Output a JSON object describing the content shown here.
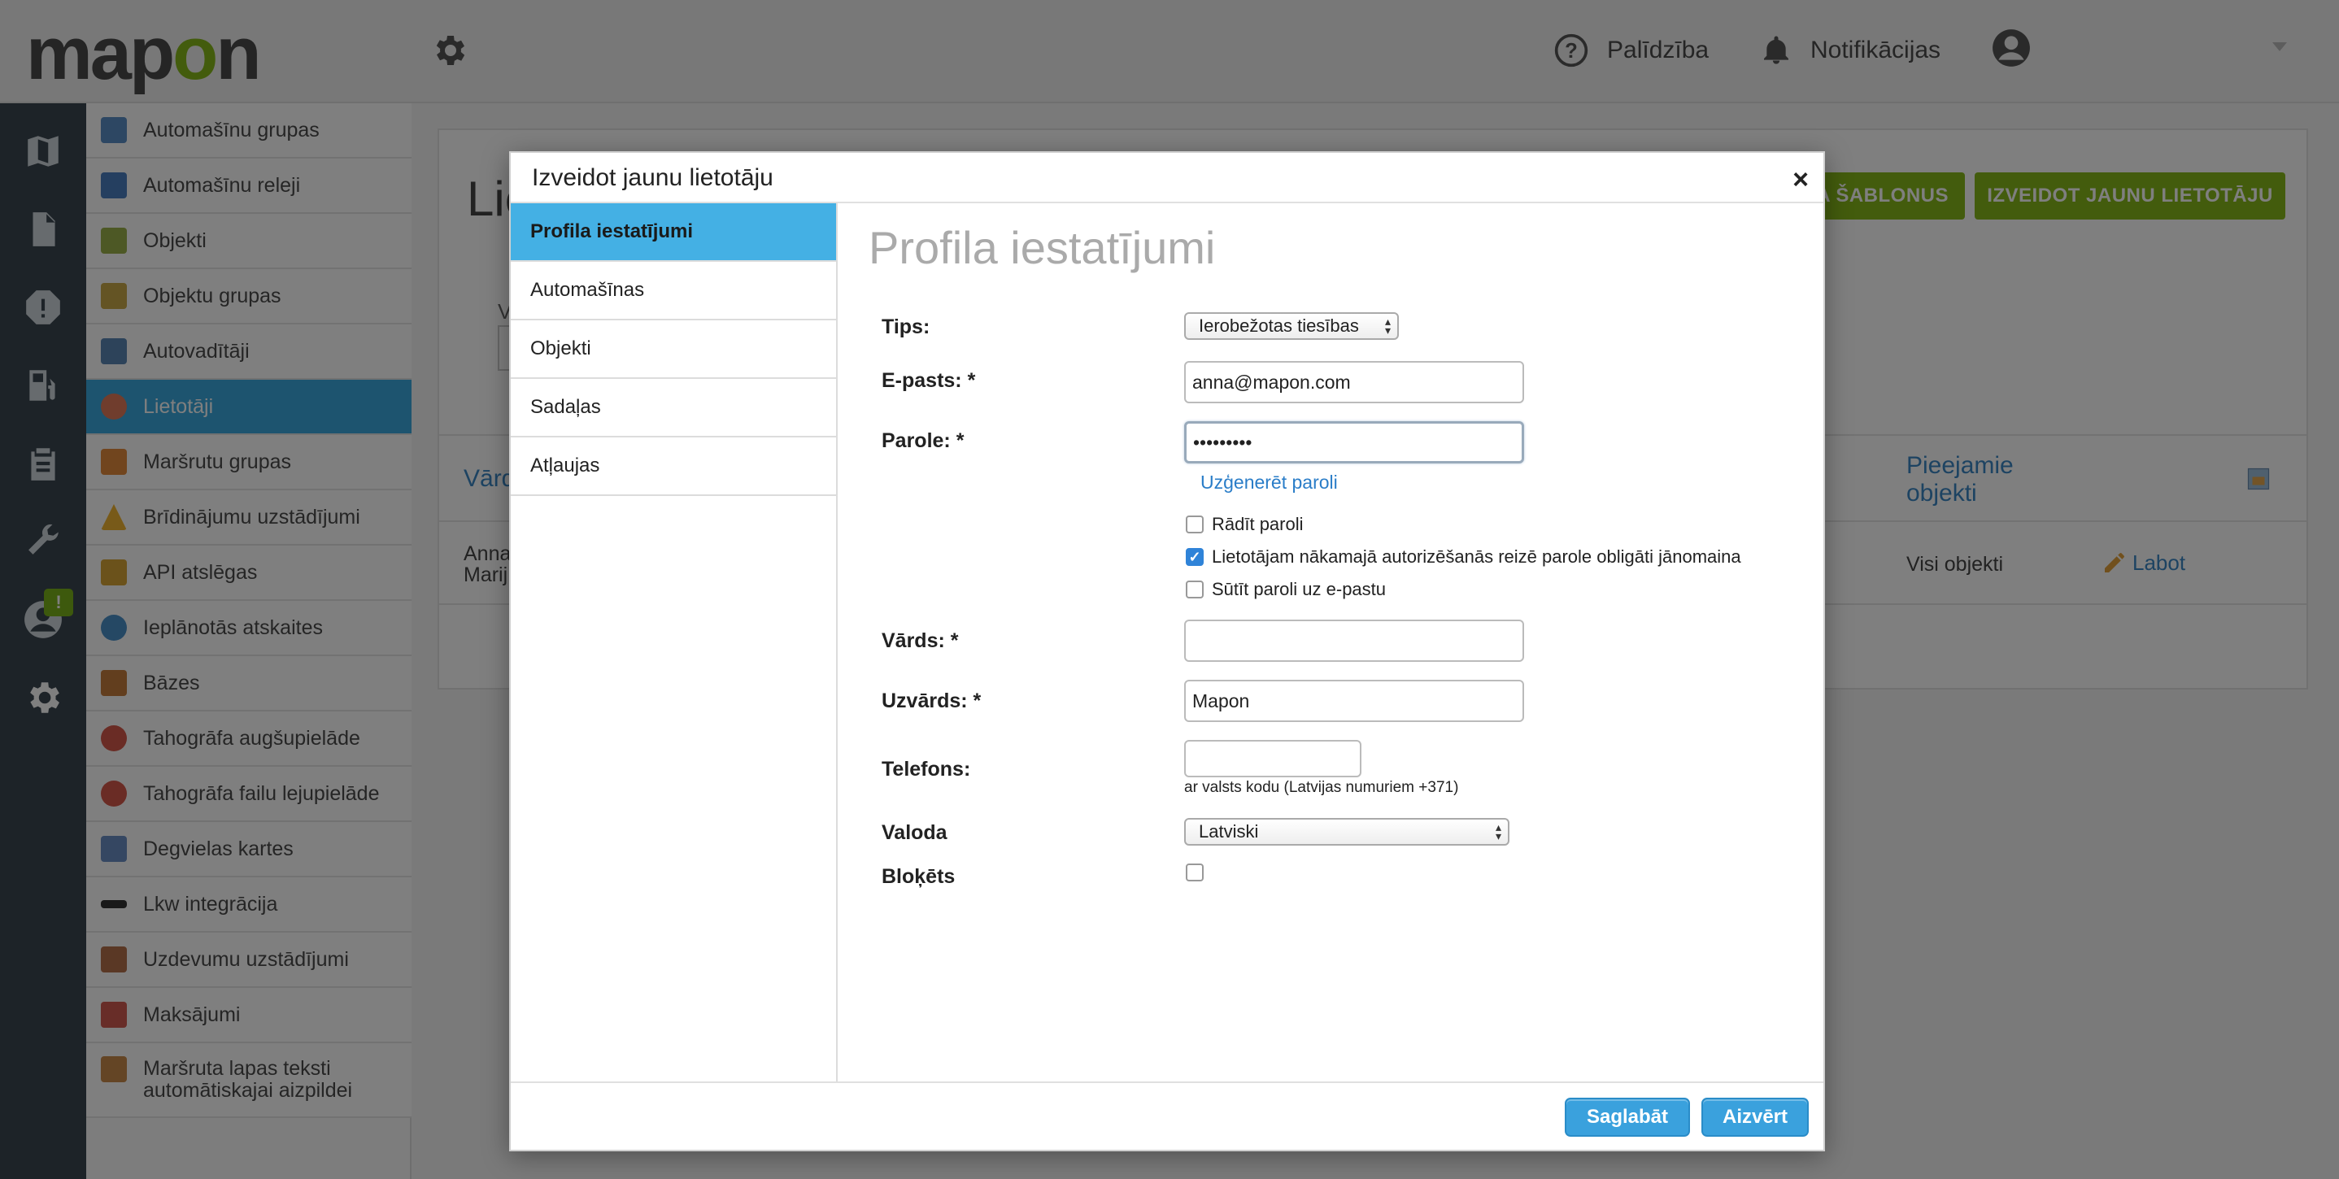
{
  "header": {
    "logo": "mapon",
    "help_label": "Palīdzība",
    "notifications_label": "Notifikācijas"
  },
  "rail": {
    "badge": "!"
  },
  "sidebar": {
    "items": [
      {
        "label": "Automašīnu grupas",
        "icon": "car-group-icon"
      },
      {
        "label": "Automašīnu releji",
        "icon": "car-relay-icon"
      },
      {
        "label": "Objekti",
        "icon": "map-object-icon"
      },
      {
        "label": "Objektu grupas",
        "icon": "object-group-icon"
      },
      {
        "label": "Autovadītāji",
        "icon": "driver-icon"
      },
      {
        "label": "Lietotāji",
        "icon": "user-icon",
        "active": true
      },
      {
        "label": "Maršrutu grupas",
        "icon": "route-group-icon"
      },
      {
        "label": "Brīdinājumu uzstādījumi",
        "icon": "warning-icon"
      },
      {
        "label": "API atslēgas",
        "icon": "key-icon"
      },
      {
        "label": "Ieplānotās atskaites",
        "icon": "clock-icon"
      },
      {
        "label": "Bāzes",
        "icon": "home-icon"
      },
      {
        "label": "Tahogrāfa augšupielāde",
        "icon": "tacho-upload-icon"
      },
      {
        "label": "Tahogrāfa failu lejupielāde",
        "icon": "tacho-download-icon"
      },
      {
        "label": "Degvielas kartes",
        "icon": "fuel-card-icon"
      },
      {
        "label": "Lkw integrācija",
        "icon": "lkw-icon"
      },
      {
        "label": "Uzdevumu uzstādījumi",
        "icon": "task-icon"
      },
      {
        "label": "Maksājumi",
        "icon": "payment-icon"
      },
      {
        "label": "Maršruta lapas teksti",
        "label2": "automātiskajai aizpildei",
        "icon": "route-sheet-icon"
      }
    ]
  },
  "background": {
    "page_title": "Lie",
    "filter_label": "V",
    "templates_button": "A ŠABLONUS",
    "create_button": "IZVEIDOT JAUNU LIETOTĀJU",
    "col_name": "Vārd",
    "col_objects_line1": "Pieejamie",
    "col_objects_line2": "objekti",
    "row_name_line1": "Anna",
    "row_name_line2": "Marij",
    "row_objects": "Visi objekti",
    "row_edit": "Labot"
  },
  "modal": {
    "title": "Izveidot jaunu lietotāju",
    "close": "×",
    "nav": [
      "Profila iestatījumi",
      "Automašīnas",
      "Objekti",
      "Sadaļas",
      "Atļaujas"
    ],
    "section_title": "Profila iestatījumi",
    "fields": {
      "type_label": "Tips:",
      "type_value": "Ierobežotas tiesības",
      "email_label": "E-pasts: *",
      "email_value": "anna@mapon.com",
      "password_label": "Parole: *",
      "password_value": "•••••••••",
      "generate_link": "Uzģenerēt paroli",
      "show_password": "Rādīt paroli",
      "show_password_checked": false,
      "force_change": "Lietotājam nākamajā autorizēšanās reizē parole obligāti jānomaina",
      "force_change_checked": true,
      "send_email": "Sūtīt paroli uz e-pastu",
      "send_email_checked": false,
      "name_label": "Vārds: *",
      "name_value": "",
      "surname_label": "Uzvārds: *",
      "surname_value": "Mapon",
      "phone_label": "Telefons:",
      "phone_value": "",
      "phone_hint": "ar valsts kodu (Latvijas numuriem +371)",
      "language_label": "Valoda",
      "language_value": "Latviski",
      "blocked_label": "Bloķēts",
      "blocked_checked": false
    },
    "save_button": "Saglabāt",
    "close_button": "Aizvērt"
  }
}
